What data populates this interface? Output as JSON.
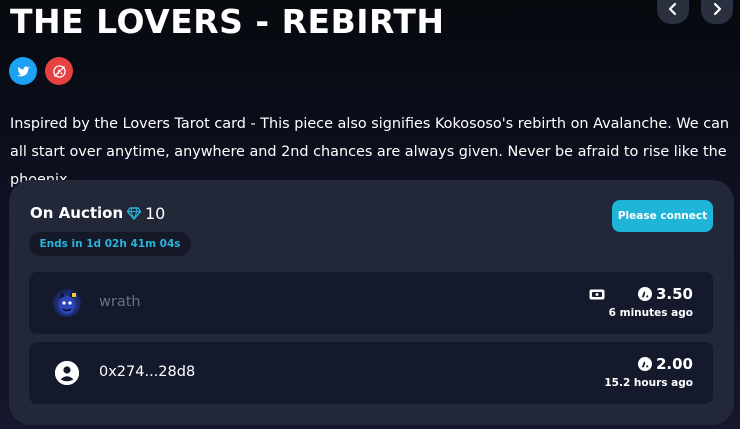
{
  "header": {
    "title": "THE LOVERS - REBIRTH",
    "prev_icon": "chevron-left-icon",
    "next_icon": "chevron-right-icon"
  },
  "socials": {
    "twitter_icon": "twitter-icon",
    "avax_icon": "avalanche-icon"
  },
  "description": "Inspired by the Lovers Tarot card - This piece also signifies Kokososo's rebirth on Avalanche. We can all start over anytime, anywhere and 2nd chances are always given. Never be afraid to rise like the phoenix.",
  "auction": {
    "status_label": "On Auction",
    "gem_icon": "gem-icon",
    "gem_count": "10",
    "ends_text": "Ends in 1d 02h 41m 04s",
    "connect_label": "Please connect"
  },
  "bids": [
    {
      "bidder": "wrath",
      "amount": "3.50",
      "time": "6 minutes ago",
      "avatar": "bidder-avatar-image",
      "badge": "ticket-icon"
    },
    {
      "bidder": "0x274...28d8",
      "amount": "2.00",
      "time": "15.2 hours ago",
      "avatar": "default-user-icon"
    }
  ],
  "colors": {
    "accent": "#1fb5d9",
    "avax_red": "#e84142",
    "twitter_blue": "#1da1f2",
    "panel": "#232839",
    "row": "#141a2b"
  }
}
